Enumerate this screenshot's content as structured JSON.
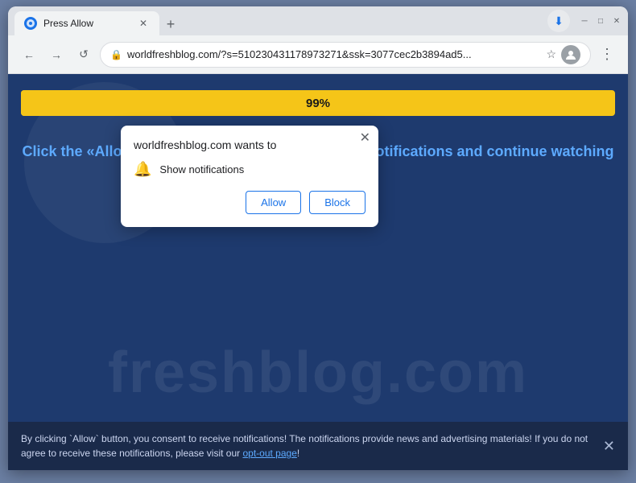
{
  "window": {
    "title": "Press Allow",
    "favicon": "●",
    "tab_close": "✕",
    "new_tab": "+",
    "minimize": "─",
    "maximize": "□",
    "close": "✕"
  },
  "navigation": {
    "back": "←",
    "forward": "→",
    "reload": "↺",
    "address": "worldfreshblog.com/?s=510230431178973271&ssk=3077cec2b3894ad5...",
    "lock_icon": "🔒",
    "star_icon": "☆",
    "profile_icon": "👤",
    "download_icon": "⬇",
    "more_icon": "⋮"
  },
  "popup": {
    "title": "worldfreshblog.com wants to",
    "close": "✕",
    "bell_icon": "🔔",
    "notification_text": "Show notifications",
    "allow_label": "Allow",
    "block_label": "Block"
  },
  "content": {
    "progress_value": "99%",
    "main_message": "Click the «Allow» button to subscribe to the push notifications and continue watching",
    "watermark": "freshblog.com"
  },
  "consent_bar": {
    "text": "By clicking `Allow` button, you consent to receive notifications! The notifications provide news and advertising materials! If you do not agree to receive these notifications, please visit our ",
    "link_text": "opt-out page",
    "text_end": "!",
    "close": "✕"
  }
}
